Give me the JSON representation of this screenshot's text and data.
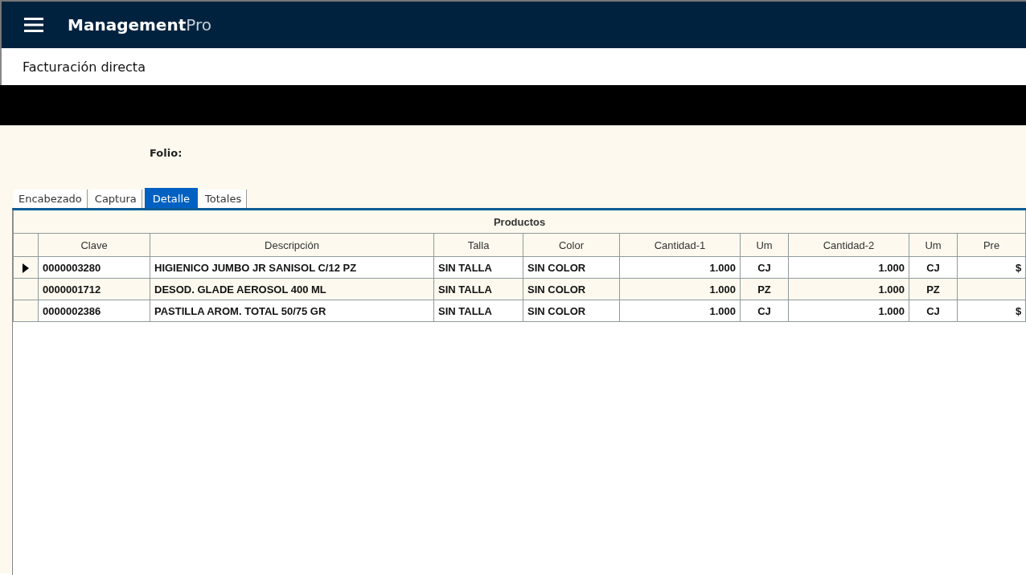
{
  "app_bar": {
    "brand_main": "Management",
    "brand_suffix": "Pro"
  },
  "page_title": "Facturación directa",
  "form": {
    "folio_label": "Folio:"
  },
  "tabs": [
    {
      "label": "Encabezado",
      "selected": false
    },
    {
      "label": "Captura",
      "selected": false
    },
    {
      "label": "Detalle",
      "selected": true
    },
    {
      "label": "Totales",
      "selected": false
    }
  ],
  "grid": {
    "group_title": "Productos",
    "columns": [
      {
        "label": "Clave"
      },
      {
        "label": "Descripción"
      },
      {
        "label": "Talla"
      },
      {
        "label": "Color"
      },
      {
        "label": "Cantidad-1"
      },
      {
        "label": "Um"
      },
      {
        "label": "Cantidad-2"
      },
      {
        "label": "Um"
      },
      {
        "label": "Pre"
      }
    ],
    "rows": [
      {
        "selected": true,
        "cells": [
          "0000003280",
          "HIGIENICO JUMBO JR SANISOL C/12 PZ",
          "SIN TALLA",
          "SIN COLOR",
          "1.000",
          "CJ",
          "1.000",
          "CJ",
          "$"
        ]
      },
      {
        "selected": false,
        "cells": [
          "0000001712",
          "DESOD. GLADE AEROSOL 400 ML",
          "SIN TALLA",
          "SIN COLOR",
          "1.000",
          "PZ",
          "1.000",
          "PZ"
        ]
      },
      {
        "selected": false,
        "cells": [
          "0000002386",
          "PASTILLA AROM. TOTAL 50/75 GR",
          "SIN TALLA",
          "SIN COLOR",
          "1.000",
          "CJ",
          "1.000",
          "CJ",
          "$"
        ]
      }
    ]
  }
}
